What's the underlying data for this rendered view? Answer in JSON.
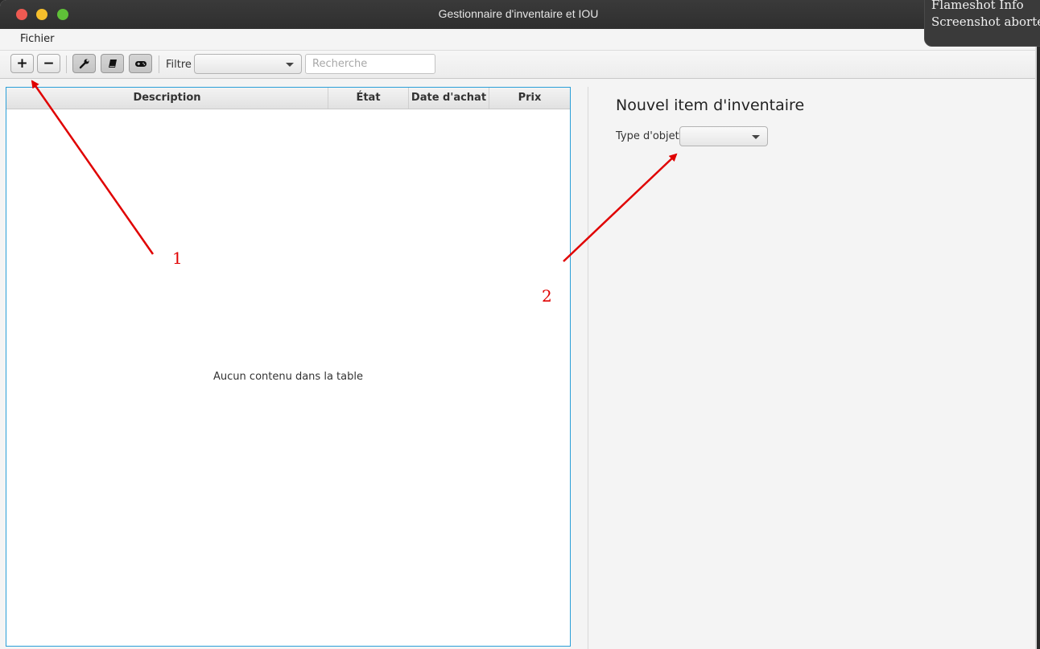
{
  "window": {
    "title": "Gestionnaire d'inventaire et IOU"
  },
  "menubar": {
    "items": [
      {
        "label": "Fichier"
      }
    ]
  },
  "toolbar": {
    "add_label": "+",
    "remove_label": "−",
    "filter_label": "Filtre",
    "filter_selected": "",
    "search_placeholder": "Recherche",
    "search_value": "",
    "toggles": [
      "wrench-icon",
      "book-icon",
      "gamepad-icon"
    ]
  },
  "table": {
    "columns": [
      "Description",
      "État",
      "Date d'achat",
      "Prix"
    ],
    "rows": [],
    "empty_text": "Aucun contenu dans la table"
  },
  "form": {
    "title": "Nouvel item d'inventaire",
    "type_label": "Type d'objet:",
    "type_selected": ""
  },
  "notification": {
    "title": "Flameshot Info",
    "body": "Screenshot aborted"
  },
  "annotations": [
    "1",
    "2"
  ],
  "colors": {
    "accent": "#2a9fd8",
    "annotation": "#e00000"
  }
}
